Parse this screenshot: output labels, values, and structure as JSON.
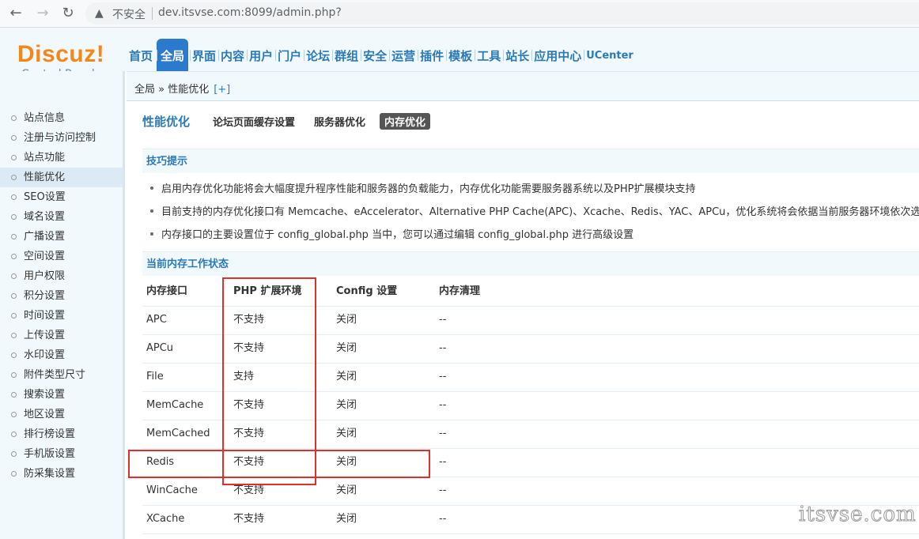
{
  "browser": {
    "security_label": "不安全",
    "url": "dev.itsvse.com:8099/admin.php?"
  },
  "logo": {
    "title": "Discuz!",
    "subtitle": "Control Panel"
  },
  "topnav": [
    "首页",
    "全局",
    "界面",
    "内容",
    "用户",
    "门户",
    "论坛",
    "群组",
    "安全",
    "运营",
    "插件",
    "模板",
    "工具",
    "站长",
    "应用中心",
    "UCenter"
  ],
  "topnav_active": "全局",
  "breadcrumb": {
    "path": "全局 » 性能优化",
    "add": "[+]"
  },
  "sidebar": [
    "站点信息",
    "注册与访问控制",
    "站点功能",
    "性能优化",
    "SEO设置",
    "域名设置",
    "广播设置",
    "空间设置",
    "用户权限",
    "积分设置",
    "时间设置",
    "上传设置",
    "水印设置",
    "附件类型尺寸",
    "搜索设置",
    "地区设置",
    "排行榜设置",
    "手机版设置",
    "防采集设置"
  ],
  "sidebar_active": "性能优化",
  "page": {
    "title": "性能优化",
    "subtabs": [
      "论坛页面缓存设置",
      "服务器优化",
      "内存优化"
    ],
    "active_subtab": "内存优化"
  },
  "tips": {
    "heading": "技巧提示",
    "items": [
      "启用内存优化功能将会大幅度提升程序性能和服务器的负载能力，内存优化功能需要服务器系统以及PHP扩展模块支持",
      "目前支持的内存优化接口有 Memcache、eAccelerator、Alternative PHP Cache(APC)、Xcache、Redis、YAC、APCu，优化系统将会依据当前服务器环境依次选用接口",
      "内存接口的主要设置位于 config_global.php 当中，您可以通过编辑 config_global.php 进行高级设置"
    ]
  },
  "status": {
    "heading": "当前内存工作状态",
    "columns": [
      "内存接口",
      "PHP 扩展环境",
      "Config 设置",
      "内存清理"
    ],
    "rows": [
      [
        "APC",
        "不支持",
        "关闭",
        "--"
      ],
      [
        "APCu",
        "不支持",
        "关闭",
        "--"
      ],
      [
        "File",
        "支持",
        "关闭",
        "--"
      ],
      [
        "MemCache",
        "不支持",
        "关闭",
        "--"
      ],
      [
        "MemCached",
        "不支持",
        "关闭",
        "--"
      ],
      [
        "Redis",
        "不支持",
        "关闭",
        "--"
      ],
      [
        "WinCache",
        "不支持",
        "关闭",
        "--"
      ],
      [
        "XCache",
        "不支持",
        "关闭",
        "--"
      ]
    ]
  },
  "watermark": "itsvse.com",
  "colors": {
    "accent": "#2b7acd",
    "highlight": "#e0302c",
    "logo": "#f2871a"
  }
}
